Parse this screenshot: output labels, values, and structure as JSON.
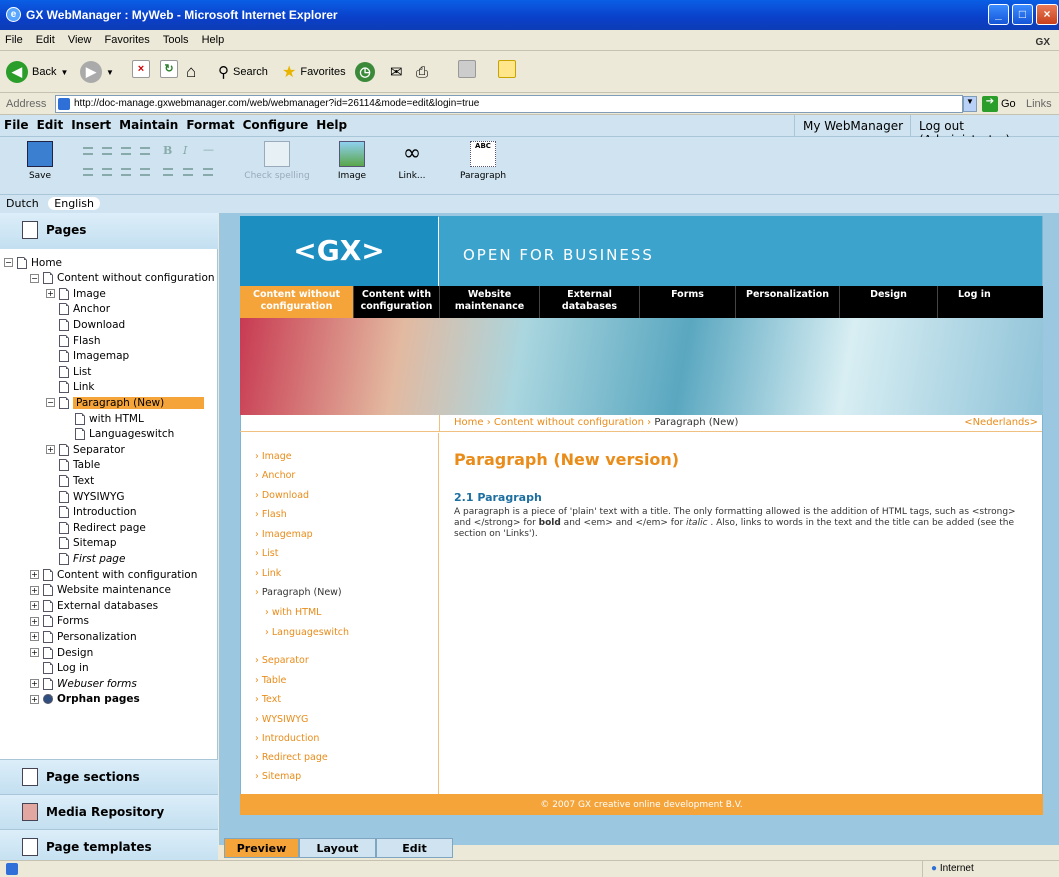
{
  "window": {
    "title": "GX WebManager : MyWeb - Microsoft Internet Explorer"
  },
  "ie_menu": [
    "File",
    "Edit",
    "View",
    "Favorites",
    "Tools",
    "Help"
  ],
  "ie_brand": "GX",
  "ie_toolbar": {
    "back": "Back",
    "search": "Search",
    "favorites": "Favorites"
  },
  "address": {
    "label": "Address",
    "url": "http://doc-manage.gxwebmanager.com/web/webmanager?id=26114&mode=edit&login=true",
    "go": "Go",
    "links": "Links"
  },
  "gx_menu": [
    "File",
    "Edit",
    "Insert",
    "Maintain",
    "Format",
    "Configure",
    "Help"
  ],
  "gx_right": {
    "my": "My WebManager",
    "logout": "Log out (Administrator)"
  },
  "editor_toolbar": {
    "save": "Save",
    "spell": "Check spelling",
    "image": "Image",
    "link": "Link...",
    "paragraph": "Paragraph"
  },
  "languages": [
    "Dutch",
    "English"
  ],
  "active_language": "English",
  "panels": {
    "pages": "Pages",
    "sections": "Page sections",
    "media": "Media Repository",
    "templates": "Page templates"
  },
  "tree": [
    {
      "label": "Home",
      "level": 0,
      "toggle": "−"
    },
    {
      "label": "Content without configuration",
      "level": 1,
      "toggle": "−"
    },
    {
      "label": "Image",
      "level": 2,
      "toggle": "+"
    },
    {
      "label": "Anchor",
      "level": 2
    },
    {
      "label": "Download",
      "level": 2
    },
    {
      "label": "Flash",
      "level": 2
    },
    {
      "label": "Imagemap",
      "level": 2
    },
    {
      "label": "List",
      "level": 2
    },
    {
      "label": "Link",
      "level": 2
    },
    {
      "label": "Paragraph (New)",
      "level": 2,
      "toggle": "−",
      "selected": true
    },
    {
      "label": "with HTML",
      "level": 3
    },
    {
      "label": "Languageswitch",
      "level": 3
    },
    {
      "label": "Separator",
      "level": 2,
      "toggle": "+"
    },
    {
      "label": "Table",
      "level": 2
    },
    {
      "label": "Text",
      "level": 2
    },
    {
      "label": "WYSIWYG",
      "level": 2
    },
    {
      "label": "Introduction",
      "level": 2
    },
    {
      "label": "Redirect page",
      "level": 2
    },
    {
      "label": "Sitemap",
      "level": 2
    },
    {
      "label": "First page",
      "level": 2,
      "italic": true
    },
    {
      "label": "Content with configuration",
      "level": 1,
      "toggle": "+"
    },
    {
      "label": "Website maintenance",
      "level": 1,
      "toggle": "+"
    },
    {
      "label": "External databases",
      "level": 1,
      "toggle": "+"
    },
    {
      "label": "Forms",
      "level": 1,
      "toggle": "+"
    },
    {
      "label": "Personalization",
      "level": 1,
      "toggle": "+"
    },
    {
      "label": "Design",
      "level": 1,
      "toggle": "+"
    },
    {
      "label": "Log in",
      "level": 1
    },
    {
      "label": "Webuser forms",
      "level": 1,
      "toggle": "+",
      "italic": true
    },
    {
      "label": "Orphan pages",
      "level": 1,
      "toggle": "+",
      "bold": true
    }
  ],
  "site": {
    "logo": "<GX>",
    "slogan": "OPEN FOR BUSINESS",
    "nav": [
      "Content without configuration",
      "Content with configuration",
      "Website maintenance",
      "External databases",
      "Forms",
      "Personalization",
      "Design",
      "Log in"
    ],
    "breadcrumb": {
      "home": "Home",
      "parent": "Content without configuration",
      "current": "Paragraph (New)",
      "lang": "<Nederlands>"
    },
    "subnav": [
      "Image",
      "Anchor",
      "Download",
      "Flash",
      "Imagemap",
      "List",
      "Link",
      "Paragraph (New)",
      "with HTML",
      "Languageswitch",
      "Separator",
      "Table",
      "Text",
      "WYSIWYG",
      "Introduction",
      "Redirect page",
      "Sitemap"
    ],
    "heading": "Paragraph (New version)",
    "section_title": "2.1 Paragraph",
    "body_1": "A paragraph is a piece of 'plain' text with a title. The only formatting allowed is the addition of HTML tags, such as <strong> and </strong> for ",
    "body_bold": "bold",
    "body_2": " and <em> and </em> for ",
    "body_italic": "italic",
    "body_3": " . Also, links to words in the text and the title can be added (see the section on 'Links').",
    "footer": "© 2007 GX creative online development B.V."
  },
  "tabs": [
    "Preview",
    "Layout",
    "Edit"
  ],
  "status": {
    "zone": "Internet"
  },
  "colors": {
    "accent": "#f5a43a",
    "header_blue": "#1d8ec0",
    "panel_blue": "#cfe4f0"
  }
}
